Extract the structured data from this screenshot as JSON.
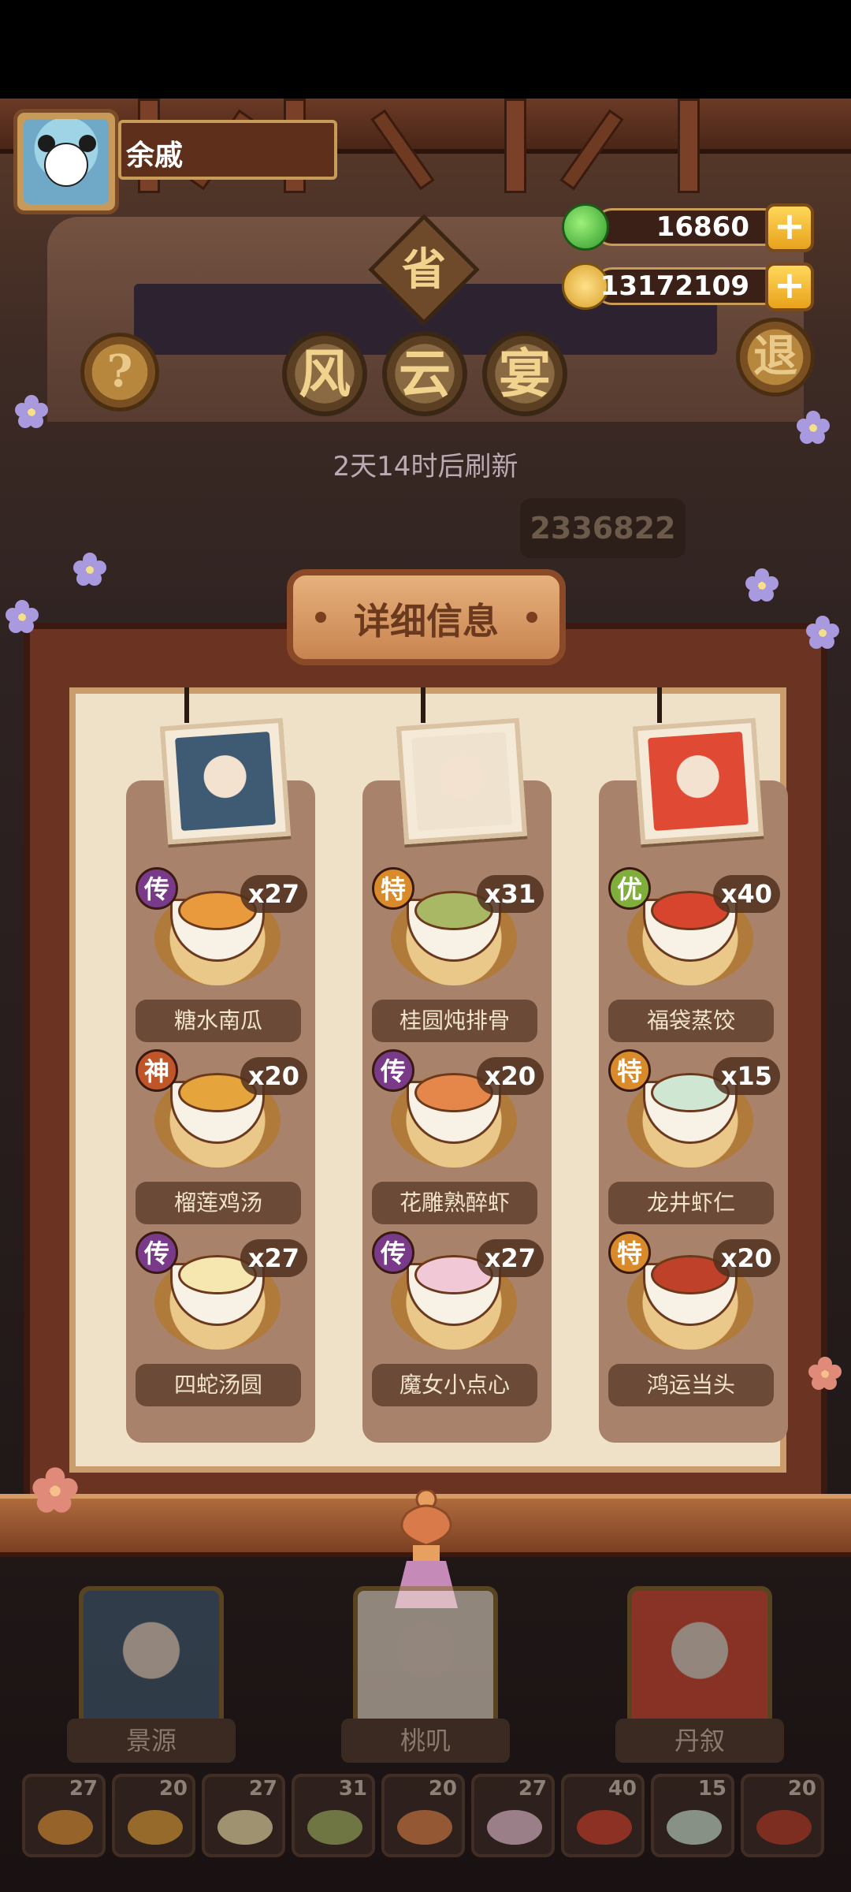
{
  "player": {
    "name": "余戚"
  },
  "currency": {
    "jade": "16860",
    "coins": "13172109",
    "plus": "+"
  },
  "event": {
    "province_badge": "省",
    "title_chars": [
      "风",
      "云",
      "宴"
    ],
    "help_label": "?",
    "exit_label": "退",
    "refresh_text": "2天14时后刷新",
    "score_partial": "2336822"
  },
  "detail_panel": {
    "title": "详细信息"
  },
  "columns": [
    {
      "chef": "景源",
      "portrait_color": "#3f5b73",
      "dishes": [
        {
          "rank": "传",
          "rank_color": "#7a3a8a",
          "qty": "x27",
          "name": "糖水南瓜",
          "food_color": "#e89a3c"
        },
        {
          "rank": "神",
          "rank_color": "#c0552a",
          "qty": "x20",
          "name": "榴莲鸡汤",
          "food_color": "#e6a53c"
        },
        {
          "rank": "传",
          "rank_color": "#7a3a8a",
          "qty": "x27",
          "name": "四蛇汤圆",
          "food_color": "#f6e7b0"
        }
      ]
    },
    {
      "chef": "桃叽",
      "portrait_color": "#efe2cf",
      "dishes": [
        {
          "rank": "特",
          "rank_color": "#d98a2a",
          "qty": "x31",
          "name": "桂圆炖排骨",
          "food_color": "#a9b864"
        },
        {
          "rank": "传",
          "rank_color": "#7a3a8a",
          "qty": "x20",
          "name": "花雕熟醉虾",
          "food_color": "#e5864a"
        },
        {
          "rank": "传",
          "rank_color": "#7a3a8a",
          "qty": "x27",
          "name": "魔女小点心",
          "food_color": "#f0c8d6"
        }
      ]
    },
    {
      "chef": "丹叙",
      "portrait_color": "#e04a34",
      "dishes": [
        {
          "rank": "优",
          "rank_color": "#7fae3a",
          "qty": "x40",
          "name": "福袋蒸饺",
          "food_color": "#d8452e"
        },
        {
          "rank": "特",
          "rank_color": "#d98a2a",
          "qty": "x15",
          "name": "龙井虾仁",
          "food_color": "#cfe6d2"
        },
        {
          "rank": "特",
          "rank_color": "#d98a2a",
          "qty": "x20",
          "name": "鸿运当头",
          "food_color": "#c0412a"
        }
      ]
    }
  ],
  "bottom_chefs": [
    "景源",
    "桃叽",
    "丹叙"
  ],
  "thumbnails": [
    {
      "count": "27",
      "color": "#e89a3c"
    },
    {
      "count": "20",
      "color": "#e6a53c"
    },
    {
      "count": "27",
      "color": "#f6e7b0"
    },
    {
      "count": "31",
      "color": "#a9b864"
    },
    {
      "count": "20",
      "color": "#e5864a"
    },
    {
      "count": "27",
      "color": "#f0c8d6"
    },
    {
      "count": "40",
      "color": "#d8452e"
    },
    {
      "count": "15",
      "color": "#cfe6d2"
    },
    {
      "count": "20",
      "color": "#c0412a"
    }
  ]
}
